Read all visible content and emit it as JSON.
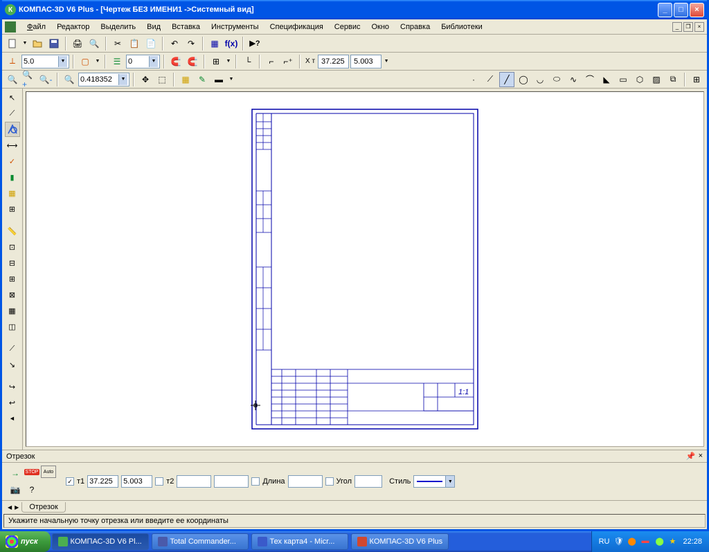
{
  "title": "КОМПАС-3D V6 Plus - [Чертеж БЕЗ ИМЕНИ1 ->Системный вид]",
  "menu": {
    "file": "Файл",
    "editor": "Редактор",
    "select": "Выделить",
    "view": "Вид",
    "insert": "Вставка",
    "tools": "Инструменты",
    "spec": "Спецификация",
    "service": "Сервис",
    "window": "Окно",
    "help": "Справка",
    "libs": "Библиотеки"
  },
  "tb2": {
    "step": "5.0",
    "zero": "0"
  },
  "tb3": {
    "zoom": "0.418352"
  },
  "coords": {
    "x_lbl": "X т",
    "x": "37.225",
    "y": "5.003"
  },
  "panel": {
    "title": "Отрезок",
    "t1": "т1",
    "t1x": "37.225",
    "t1y": "5.003",
    "t2": "т2",
    "t2x": "",
    "t2y": "",
    "len_lbl": "Длина",
    "len": "",
    "ang_lbl": "Угол",
    "ang": "",
    "style_lbl": "Стиль",
    "tab_name": "Отрезок"
  },
  "status": "Укажите начальную точку отрезка или введите ее координаты",
  "taskbar": {
    "start": "пуск",
    "t1": "КОМПАС-3D V6 Pl...",
    "t2": "Total Commander...",
    "t3": "Тех карта4 - Micr...",
    "t4": "КОМПАС-3D V6 Plus",
    "lang": "RU",
    "time": "22:28"
  }
}
